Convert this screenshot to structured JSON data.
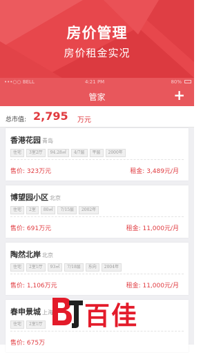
{
  "hero": {
    "title": "房价管理",
    "subtitle": "房价租金实况"
  },
  "status_bar": {
    "carrier": "•••○○ BELL",
    "time": "4:21 PM",
    "battery": "80%"
  },
  "nav": {
    "title": "管家",
    "add": "+"
  },
  "summary": {
    "label": "总市值:",
    "value": "2,795",
    "unit": "万元"
  },
  "properties": [
    {
      "name": "香港花园",
      "city": "青岛",
      "tags": [
        "住宅",
        "3室2厅",
        "94.28㎡",
        "4/7层",
        "平层",
        "2000年"
      ],
      "price": "售价: 323万元",
      "rent": "租金: 3,489元/月"
    },
    {
      "name": "博望园小区",
      "city": "北京",
      "tags": [
        "住宅",
        "2室",
        "80㎡",
        "7/15层",
        "2002年"
      ],
      "price": "售价: 691万元",
      "rent": "租金: 11,000元/月"
    },
    {
      "name": "陶然北岸",
      "city": "北京",
      "tags": [
        "住宅",
        "2室1厅",
        "93㎡",
        "7/18层",
        "东向",
        "2004年"
      ],
      "price": "售价: 1,106万元",
      "rent": "租金: 11,000元/月"
    },
    {
      "name": "春申景城",
      "city": "上海",
      "tags": [
        "住宅",
        "2室1厅"
      ],
      "price": "售价: 675万",
      "rent": ""
    }
  ],
  "watermark": {
    "logo_text": "百佳"
  },
  "colors": {
    "brand_red": "#e7474c",
    "price_red": "#e03a3f"
  }
}
